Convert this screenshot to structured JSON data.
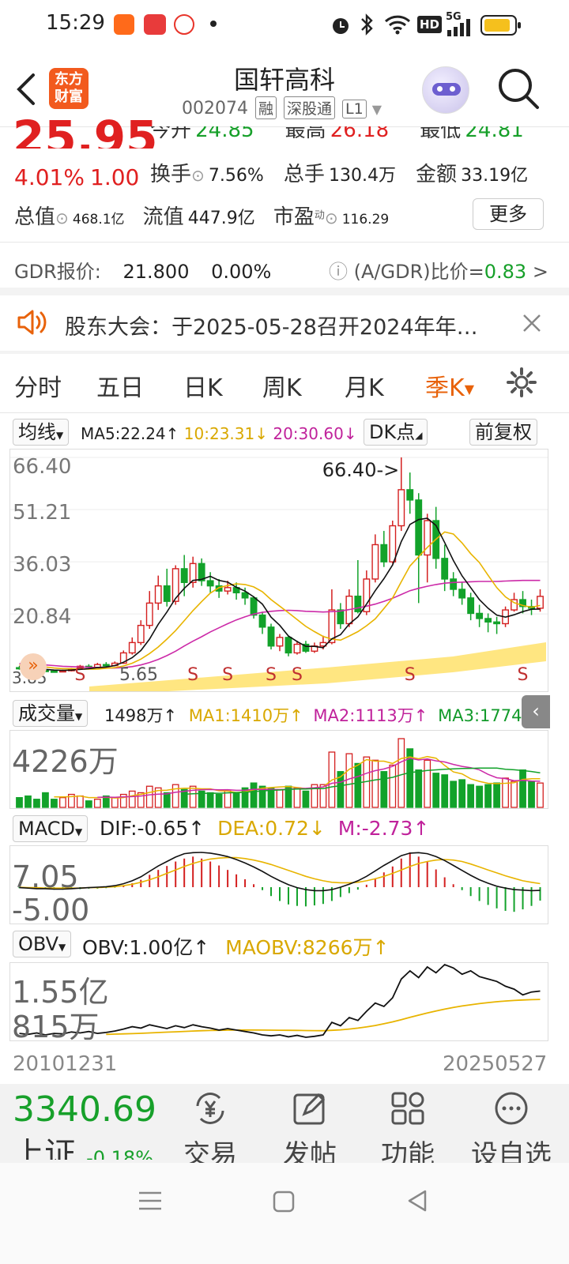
{
  "status_bar": {
    "time": "15:29",
    "app_icons": [
      "east-money-app-icon",
      "toutiao-app-icon",
      "weibo-app-icon"
    ],
    "right_icons": [
      "alarm-icon",
      "bluetooth-icon",
      "wifi-icon",
      "hd-icon",
      "5g-signal-icon",
      "battery-icon"
    ],
    "hd": "HD",
    "net": "5G"
  },
  "header": {
    "logo_text": "东方\n财富",
    "title": "国轩高科",
    "code": "002074",
    "tags": [
      "融",
      "深股通",
      "L1"
    ]
  },
  "quote": {
    "price": "25.95",
    "change_pct": "4.01%",
    "change": "1.00",
    "fields": {
      "open_label": "今开",
      "open": "24.85",
      "high_label": "最高",
      "high": "26.18",
      "low_label": "最低",
      "low": "24.81",
      "turnover_label": "换手",
      "turnover": "7.56%",
      "volume_label": "总手",
      "volume": "130.4万",
      "amount_label": "金额",
      "amount": "33.19亿",
      "mktcap_label": "总值",
      "mktcap": "468.1亿",
      "float_label": "流值",
      "float": "447.9亿",
      "pe_label": "市盈",
      "pe_sup": "动",
      "pe": "116.29"
    },
    "more_button": "更多"
  },
  "gdr": {
    "label": "GDR报价:",
    "price": "21.800",
    "pct": "0.00%",
    "ratio_label": "(A/GDR)比价=",
    "ratio": "0.83",
    "arrow": ">"
  },
  "notice": {
    "text": "股东大会：于2025-05-28召开2024年年…"
  },
  "tabs": [
    "分时",
    "五日",
    "日K",
    "周K",
    "月K",
    "季K"
  ],
  "active_tab": "季K",
  "chart_toolbar": {
    "ma_selector": "均线",
    "ma5": "MA5:22.24",
    "ma10": "10:23.31",
    "ma20": "20:30.60",
    "dk_button": "DK点",
    "adjust_button": "前复权"
  },
  "colors": {
    "up": "#d42020",
    "down": "#12a22a",
    "ma5": "#111111",
    "ma10": "#e8b400",
    "ma20": "#cc2aa8",
    "accent": "#e8620a"
  },
  "chart_data": [
    {
      "type": "candlestick",
      "title": "",
      "y_ticks": [
        "66.40",
        "51.21",
        "36.03",
        "20.84",
        "5.65"
      ],
      "high_marker": "66.40->",
      "low_label": "3.85",
      "signal_labels": [
        "S",
        "S",
        "S",
        "S",
        "S",
        "S",
        "S"
      ],
      "candles": [
        [
          5.2,
          4.9,
          5.6,
          4.6
        ],
        [
          4.9,
          4.6,
          5.2,
          4.3
        ],
        [
          4.6,
          4.4,
          4.9,
          4.2
        ],
        [
          4.4,
          4.2,
          4.7,
          4.0
        ],
        [
          4.2,
          4.0,
          4.5,
          3.9
        ],
        [
          4.0,
          4.3,
          4.6,
          3.85
        ],
        [
          4.3,
          4.8,
          5.1,
          4.1
        ],
        [
          4.8,
          5.6,
          6.0,
          4.6
        ],
        [
          5.6,
          5.3,
          6.2,
          5.0
        ],
        [
          5.3,
          6.1,
          6.6,
          5.1
        ],
        [
          6.1,
          5.8,
          6.8,
          5.5
        ],
        [
          5.8,
          6.5,
          7.0,
          5.6
        ],
        [
          6.5,
          9.5,
          10.2,
          6.3
        ],
        [
          9.5,
          12.5,
          14.0,
          9.0
        ],
        [
          12.5,
          17.5,
          19.0,
          11.8
        ],
        [
          17.5,
          24.0,
          27.5,
          16.5
        ],
        [
          24.0,
          29.0,
          32.0,
          22.0
        ],
        [
          29.0,
          24.5,
          34.0,
          23.0
        ],
        [
          24.5,
          34.0,
          35.0,
          23.5
        ],
        [
          34.0,
          30.0,
          38.0,
          26.0
        ],
        [
          30.0,
          35.5,
          37.5,
          28.5
        ],
        [
          35.5,
          30.5,
          37.0,
          29.0
        ],
        [
          30.5,
          29.0,
          33.0,
          27.0
        ],
        [
          29.0,
          27.5,
          31.0,
          25.5
        ],
        [
          27.5,
          28.5,
          30.5,
          26.5
        ],
        [
          28.5,
          27.0,
          30.0,
          25.0
        ],
        [
          27.0,
          25.5,
          28.5,
          23.5
        ],
        [
          25.5,
          20.5,
          26.0,
          19.5
        ],
        [
          20.5,
          17.0,
          21.5,
          15.0
        ],
        [
          17.0,
          11.5,
          18.0,
          10.5
        ],
        [
          11.5,
          14.0,
          15.0,
          10.0
        ],
        [
          14.0,
          9.5,
          14.5,
          8.5
        ],
        [
          9.5,
          12.0,
          13.0,
          9.0
        ],
        [
          12.0,
          10.0,
          13.0,
          9.5
        ],
        [
          10.0,
          11.5,
          12.5,
          9.5
        ],
        [
          11.5,
          12.5,
          14.5,
          10.5
        ],
        [
          12.5,
          22.0,
          28.0,
          12.0
        ],
        [
          22.0,
          18.0,
          24.0,
          16.5
        ],
        [
          18.0,
          26.0,
          28.0,
          17.0
        ],
        [
          26.0,
          21.5,
          36.5,
          21.0
        ],
        [
          21.5,
          31.0,
          33.5,
          20.5
        ],
        [
          31.0,
          41.0,
          44.0,
          30.0
        ],
        [
          41.0,
          36.0,
          45.0,
          34.5
        ],
        [
          36.0,
          46.5,
          48.0,
          35.5
        ],
        [
          46.5,
          57.0,
          66.4,
          45.0
        ],
        [
          57.0,
          54.0,
          62.0,
          50.0
        ],
        [
          54.0,
          38.0,
          56.0,
          24.0
        ],
        [
          38.0,
          48.0,
          50.0,
          30.0
        ],
        [
          48.0,
          37.0,
          52.0,
          34.0
        ],
        [
          37.0,
          31.0,
          41.0,
          27.5
        ],
        [
          31.0,
          28.0,
          33.0,
          26.0
        ],
        [
          28.0,
          25.5,
          30.0,
          23.5
        ],
        [
          25.5,
          21.0,
          27.0,
          19.0
        ],
        [
          21.0,
          19.5,
          23.5,
          17.0
        ],
        [
          19.5,
          18.5,
          21.0,
          15.5
        ],
        [
          18.5,
          18.0,
          20.0,
          15.0
        ],
        [
          18.0,
          22.0,
          23.0,
          17.0
        ],
        [
          22.0,
          25.0,
          27.0,
          21.5
        ],
        [
          25.0,
          23.0,
          27.5,
          21.0
        ],
        [
          23.0,
          22.5,
          25.0,
          20.5
        ],
        [
          22.5,
          25.95,
          28.0,
          21.5
        ]
      ],
      "ma5": [
        5.6,
        5.3,
        5.0,
        4.7,
        4.5,
        4.4,
        4.5,
        4.7,
        4.9,
        5.2,
        5.4,
        5.8,
        6.8,
        8.1,
        10.2,
        13.5,
        17.8,
        21.4,
        25.4,
        28.3,
        30.6,
        30.9,
        31.8,
        30.6,
        30.1,
        28.6,
        27.5,
        25.8,
        23.7,
        19.9,
        17.5,
        14.4,
        12.8,
        11.4,
        11.4,
        11.0,
        13.6,
        14.8,
        17.9,
        20.0,
        23.7,
        27.6,
        31.1,
        35.1,
        41.9,
        46.9,
        48.3,
        48.7,
        46.6,
        41.6,
        36.4,
        31.9,
        28.5,
        25.0,
        22.5,
        20.5,
        19.9,
        20.6,
        21.5,
        22.2,
        22.24
      ],
      "ma10": [
        6.0,
        5.8,
        5.6,
        5.4,
        5.1,
        4.9,
        4.9,
        4.8,
        4.8,
        4.8,
        5.0,
        5.2,
        5.7,
        6.5,
        7.7,
        9.3,
        11.2,
        13.5,
        16.0,
        18.9,
        21.8,
        24.4,
        26.9,
        28.5,
        29.1,
        29.6,
        29.4,
        28.7,
        27.3,
        25.0,
        23.1,
        21.2,
        19.2,
        17.2,
        15.7,
        14.3,
        13.5,
        13.2,
        14.4,
        15.7,
        17.4,
        19.4,
        22.4,
        25.5,
        30.2,
        34.8,
        37.5,
        40.2,
        42.6,
        44.7,
        44.1,
        41.5,
        38.4,
        35.8,
        32.1,
        28.5,
        25.8,
        24.1,
        23.3,
        22.8,
        23.31
      ],
      "ma20": [
        6.4,
        6.3,
        6.2,
        6.0,
        5.8,
        5.6,
        5.5,
        5.4,
        5.3,
        5.2,
        5.1,
        5.1,
        5.2,
        5.5,
        6.0,
        6.7,
        7.6,
        8.7,
        10.0,
        11.5,
        12.9,
        14.2,
        15.6,
        16.8,
        18.0,
        19.1,
        20.0,
        20.8,
        21.3,
        21.6,
        21.8,
        21.9,
        21.8,
        21.6,
        21.5,
        21.4,
        21.5,
        21.7,
        22.1,
        22.6,
        23.1,
        23.7,
        24.5,
        25.4,
        26.5,
        27.6,
        28.3,
        28.9,
        29.4,
        29.8,
        30.0,
        30.1,
        30.2,
        30.3,
        30.3,
        30.3,
        30.4,
        30.5,
        30.6,
        30.6,
        30.6
      ]
    },
    {
      "type": "bar",
      "title": "",
      "legend": {
        "selector": "成交量",
        "vol": "1498万",
        "ma1": "MA1:1410万",
        "ma2": "MA2:1113万",
        "ma3": "MA3:1774万"
      },
      "y_ticks": [
        "4226万"
      ],
      "values": [
        600,
        700,
        500,
        900,
        500,
        600,
        800,
        700,
        400,
        500,
        700,
        600,
        800,
        1000,
        900,
        1300,
        1200,
        900,
        1400,
        1100,
        1300,
        1000,
        900,
        800,
        1000,
        900,
        1200,
        1500,
        1300,
        1200,
        1100,
        1300,
        1200,
        1000,
        1400,
        1400,
        3400,
        2200,
        3300,
        2700,
        3100,
        2900,
        2200,
        2600,
        4226,
        3600,
        2300,
        2900,
        2100,
        2000,
        1600,
        1700,
        1400,
        1300,
        1400,
        1500,
        1800,
        1600,
        2300,
        1600,
        1498
      ]
    },
    {
      "type": "bar",
      "title": "",
      "legend": {
        "selector": "MACD",
        "dif": "DIF:-0.65",
        "dea": "DEA:0.72",
        "m": "M:-2.73"
      },
      "y_ticks": [
        "7.05",
        "-5.00"
      ],
      "values": [
        -0.2,
        -0.3,
        -0.4,
        -0.4,
        -0.5,
        -0.5,
        -0.4,
        -0.4,
        -0.3,
        -0.3,
        -0.2,
        -0.1,
        0.3,
        0.8,
        1.5,
        2.5,
        3.5,
        4.3,
        5.2,
        5.8,
        6.2,
        5.8,
        5.2,
        4.4,
        3.5,
        2.6,
        1.6,
        0.6,
        -0.6,
        -1.8,
        -2.8,
        -3.5,
        -3.8,
        -3.9,
        -3.7,
        -3.4,
        -2.8,
        -2.0,
        -1.2,
        -0.5,
        0.5,
        1.8,
        3.0,
        4.2,
        5.8,
        7.05,
        6.2,
        5.2,
        3.6,
        2.0,
        0.6,
        -0.6,
        -1.8,
        -2.8,
        -3.6,
        -4.3,
        -4.8,
        -5.0,
        -4.5,
        -3.8,
        -2.73
      ],
      "dif": [
        -0.1,
        -0.2,
        -0.3,
        -0.3,
        -0.4,
        -0.4,
        -0.3,
        -0.2,
        -0.1,
        0.0,
        0.1,
        0.3,
        0.7,
        1.3,
        2.1,
        3.2,
        4.3,
        5.2,
        6.1,
        6.8,
        7.0,
        7.05,
        6.9,
        6.6,
        6.2,
        5.6,
        4.9,
        4.1,
        3.2,
        2.2,
        1.3,
        0.5,
        -0.1,
        -0.5,
        -0.7,
        -0.7,
        -0.5,
        0.0,
        0.6,
        1.3,
        2.2,
        3.3,
        4.4,
        5.4,
        6.4,
        6.9,
        7.0,
        6.8,
        6.2,
        5.4,
        4.4,
        3.4,
        2.4,
        1.5,
        0.8,
        0.2,
        -0.2,
        -0.5,
        -0.6,
        -0.7,
        -0.65
      ],
      "dea": [
        0.0,
        -0.1,
        -0.1,
        -0.2,
        -0.2,
        -0.2,
        -0.2,
        -0.2,
        -0.1,
        -0.1,
        0.0,
        0.1,
        0.3,
        0.6,
        1.0,
        1.5,
        2.1,
        2.8,
        3.5,
        4.2,
        4.8,
        5.3,
        5.7,
        5.9,
        6.0,
        6.0,
        5.8,
        5.5,
        5.1,
        4.6,
        4.0,
        3.4,
        2.8,
        2.2,
        1.7,
        1.3,
        1.0,
        0.9,
        0.9,
        1.0,
        1.3,
        1.7,
        2.2,
        2.8,
        3.5,
        4.2,
        4.8,
        5.2,
        5.5,
        5.6,
        5.5,
        5.2,
        4.7,
        4.1,
        3.5,
        2.9,
        2.3,
        1.8,
        1.3,
        1.0,
        0.72
      ]
    },
    {
      "type": "line",
      "title": "",
      "legend": {
        "selector": "OBV",
        "obv": "OBV:1.00亿",
        "maobv": "MAOBV:8266万"
      },
      "y_ticks": [
        "1.55亿",
        "815万"
      ],
      "obv": [
        1200,
        1000,
        1300,
        900,
        1200,
        1100,
        1500,
        1300,
        1600,
        1200,
        1400,
        1700,
        2100,
        2600,
        2300,
        3000,
        2600,
        2200,
        2800,
        2400,
        3000,
        2600,
        2300,
        1900,
        2200,
        1900,
        1600,
        1300,
        900,
        700,
        900,
        500,
        800,
        400,
        600,
        900,
        3500,
        2800,
        4500,
        3900,
        5800,
        7500,
        6800,
        8600,
        12500,
        14200,
        12800,
        15000,
        13800,
        15500,
        14800,
        13500,
        14200,
        13000,
        12500,
        12000,
        11000,
        10400,
        9200,
        9800,
        10000
      ],
      "maobv": [
        null,
        null,
        null,
        null,
        null,
        null,
        null,
        null,
        null,
        null,
        1000,
        1050,
        1100,
        1160,
        1220,
        1300,
        1380,
        1460,
        1540,
        1620,
        1700,
        1760,
        1810,
        1850,
        1880,
        1900,
        1910,
        1910,
        1900,
        1880,
        1860,
        1840,
        1820,
        1800,
        1780,
        1760,
        1850,
        1950,
        2100,
        2300,
        2550,
        2850,
        3200,
        3600,
        4050,
        4550,
        5000,
        5450,
        5850,
        6250,
        6600,
        6900,
        7150,
        7400,
        7600,
        7780,
        7930,
        8050,
        8150,
        8220,
        8266
      ]
    }
  ],
  "date_range": {
    "start": "20101231",
    "end": "20250527"
  },
  "bottom_nav": {
    "index_value": "3340.69",
    "index_name": "上证",
    "index_change": "-0.18%",
    "items": [
      {
        "label": "交易",
        "icon": "yuan-exchange-icon"
      },
      {
        "label": "发帖",
        "icon": "edit-post-icon"
      },
      {
        "label": "功能",
        "icon": "grid-apps-icon"
      },
      {
        "label": "设自选",
        "icon": "more-dots-icon"
      }
    ]
  }
}
